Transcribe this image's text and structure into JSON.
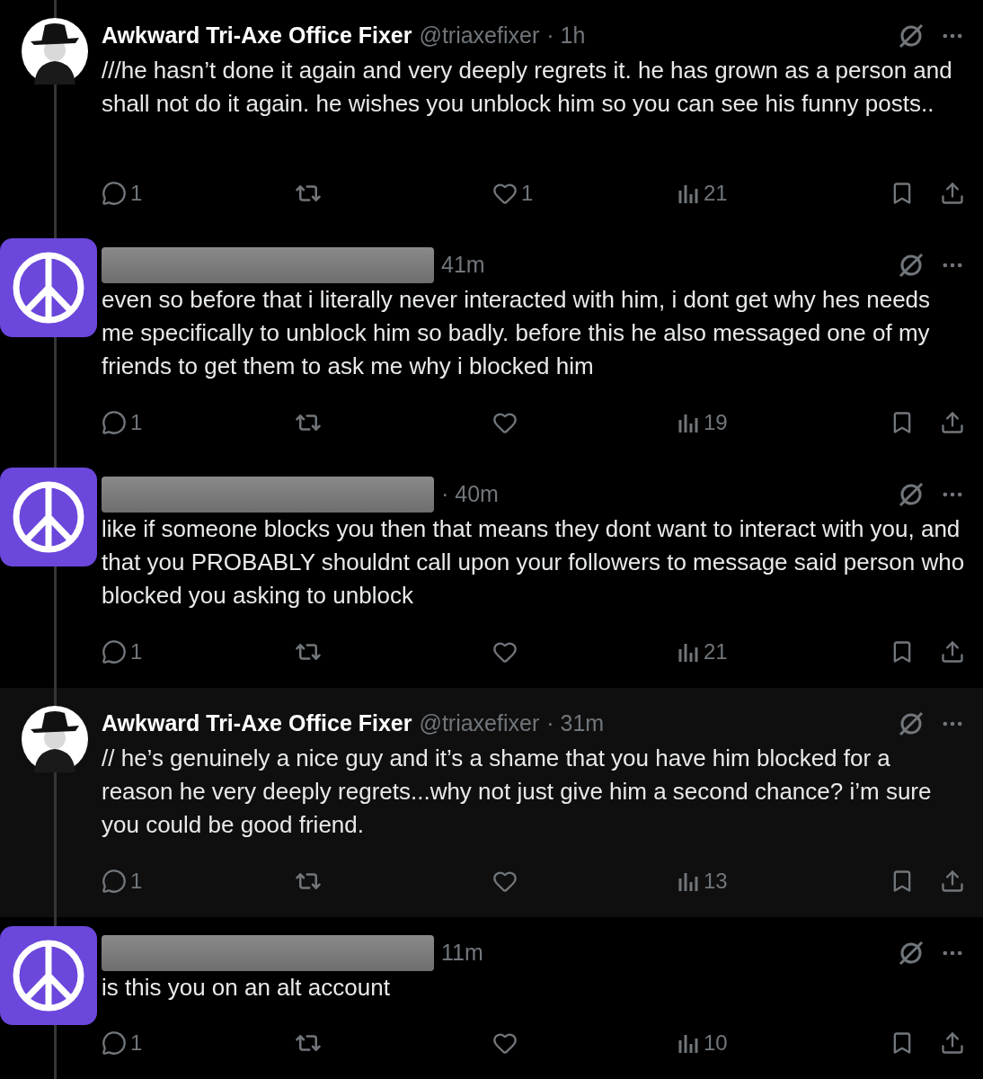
{
  "tweets": [
    {
      "kind": "named",
      "avatar": {
        "kind": "photo"
      },
      "highlighted": false,
      "name": "Awkward Tri-Axe Office Fixer",
      "handle": "@triaxefixer",
      "time": "· 1h",
      "text": "///he hasn’t done it again and very deeply regrets it. he has grown as a person and shall not do it again. he wishes you unblock him so you can see his funny posts..",
      "stats": {
        "replies": "1",
        "likes": "1",
        "views": "21"
      }
    },
    {
      "kind": "redacted",
      "avatar": {
        "kind": "peace"
      },
      "highlighted": false,
      "time": "41m",
      "text": "even so before that i literally never interacted with him, i dont get why hes needs me specifically to unblock him so badly. before this he also messaged one of my friends to get them to ask me why i blocked him",
      "stats": {
        "replies": "1",
        "views": "19"
      }
    },
    {
      "kind": "redacted",
      "avatar": {
        "kind": "peace"
      },
      "highlighted": false,
      "time": "· 40m",
      "text": "like if someone blocks you then that means they dont want to interact with you, and that you PROBABLY shouldnt call upon your followers to message said person who blocked you asking to unblock",
      "stats": {
        "replies": "1",
        "views": "21"
      }
    },
    {
      "kind": "named",
      "avatar": {
        "kind": "photo"
      },
      "highlighted": true,
      "name": "Awkward Tri-Axe Office Fixer",
      "handle": "@triaxefixer",
      "time": "· 31m",
      "text": "// he’s genuinely a nice guy and it’s a shame that you have him blocked for a reason he very deeply regrets...why not just give him a second chance? i’m sure you could be good friend.",
      "stats": {
        "replies": "1",
        "views": "13"
      }
    },
    {
      "kind": "redacted",
      "avatar": {
        "kind": "peace"
      },
      "highlighted": false,
      "time": "11m",
      "text": "is this you on an alt account",
      "stats": {
        "replies": "1",
        "views": "10"
      }
    }
  ]
}
